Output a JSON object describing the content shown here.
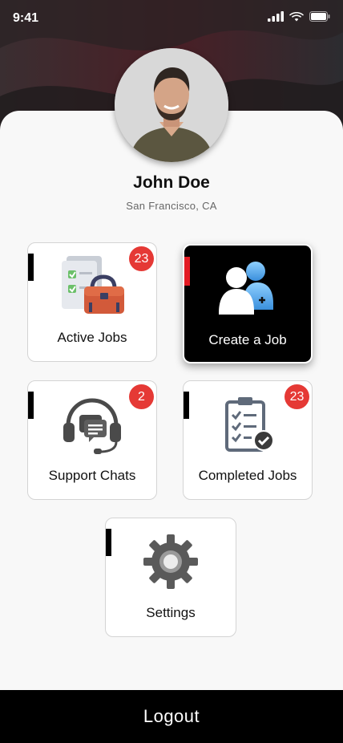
{
  "status_bar": {
    "time": "9:41"
  },
  "profile": {
    "name": "John Doe",
    "location": "San Francisco, CA"
  },
  "tiles": [
    {
      "label": "Active Jobs",
      "badge": "23",
      "icon": "jobs-icon"
    },
    {
      "label": "Create a Job",
      "icon": "add-user-icon"
    },
    {
      "label": "Support Chats",
      "badge": "2",
      "icon": "headset-icon"
    },
    {
      "label": "Completed Jobs",
      "badge": "23",
      "icon": "clipboard-check-icon"
    },
    {
      "label": "Settings",
      "icon": "gear-icon"
    }
  ],
  "logout_label": "Logout",
  "colors": {
    "badge": "#e53935",
    "accent_red": "#e31b23",
    "dark": "#000000"
  }
}
